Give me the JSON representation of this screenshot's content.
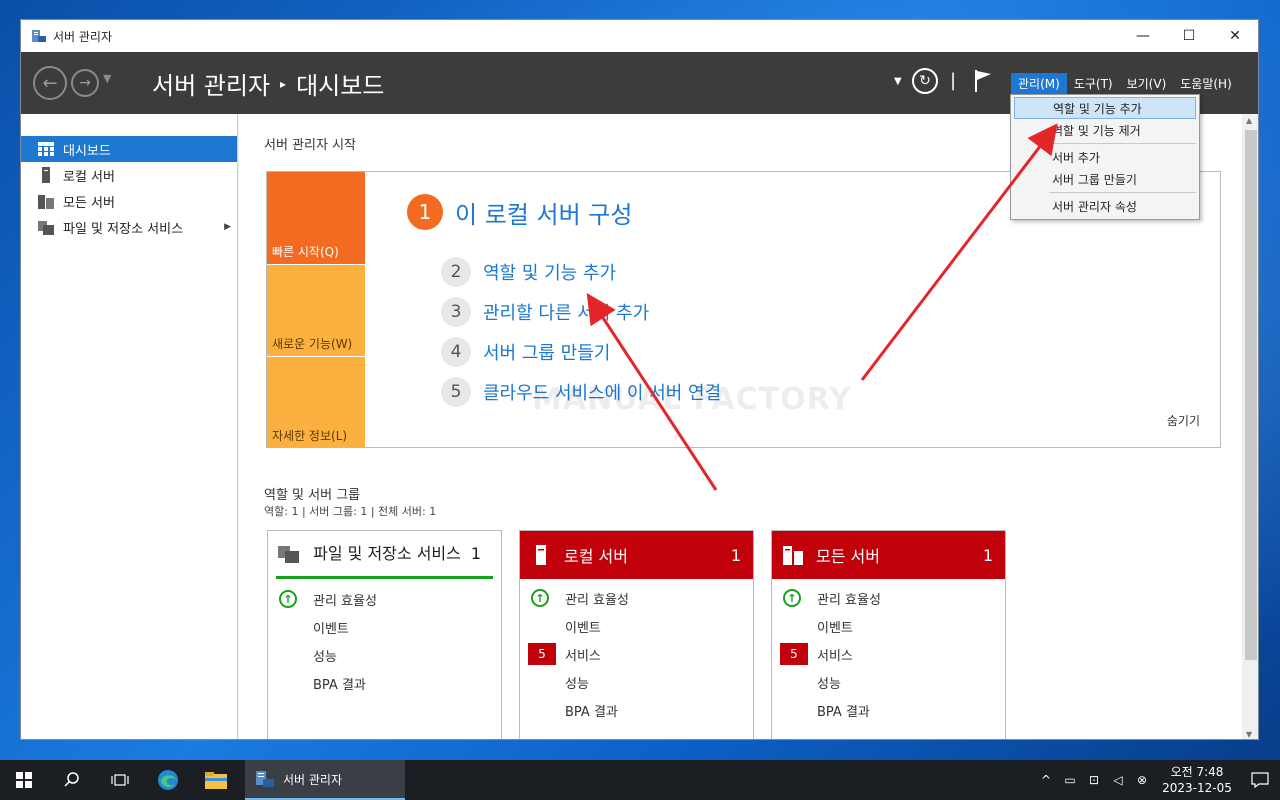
{
  "window": {
    "title": "서버 관리자",
    "minimize": "—",
    "maximize": "☐",
    "close": "✕"
  },
  "header": {
    "title": "서버 관리자",
    "separator": "▸",
    "page": "대시보드"
  },
  "menubar": {
    "items": [
      "관리(M)",
      "도구(T)",
      "보기(V)",
      "도움말(H)"
    ],
    "active_index": 0
  },
  "dropdown": {
    "items": [
      "역할 및 기능 추가",
      "역할 및 기능 제거",
      "서버 추가",
      "서버 그룹 만들기",
      "서버 관리자 속성"
    ]
  },
  "sidebar": {
    "items": [
      {
        "label": "대시보드",
        "icon": "dashboard-icon",
        "selected": true
      },
      {
        "label": "로컬 서버",
        "icon": "server-icon"
      },
      {
        "label": "모든 서버",
        "icon": "servers-icon"
      },
      {
        "label": "파일 및 저장소 서비스",
        "icon": "storage-icon",
        "has_children": true
      }
    ]
  },
  "quickstart": {
    "section_title": "서버 관리자 시작",
    "tabs": [
      "빠른 시작(Q)",
      "새로운 기능(W)",
      "자세한 정보(L)"
    ],
    "main_step": {
      "num": "1",
      "label": "이 로컬 서버 구성"
    },
    "steps": [
      {
        "num": "2",
        "label": "역할 및 기능 추가"
      },
      {
        "num": "3",
        "label": "관리할 다른 서버 추가"
      },
      {
        "num": "4",
        "label": "서버 그룹 만들기"
      },
      {
        "num": "5",
        "label": "클라우드 서비스에 이 서버 연결"
      }
    ],
    "hide": "숨기기",
    "watermark": "MANUAL FACTORY"
  },
  "roles": {
    "title": "역할 및 서버 그룹",
    "summary": "역할: 1   |   서버 그룹: 1   |   전체 서버: 1",
    "tiles": [
      {
        "name": "파일 및 저장소 서비스",
        "count": "1",
        "style": "green",
        "rows": [
          {
            "label": "관리 효율성",
            "badge": "ok"
          },
          {
            "label": "이벤트"
          },
          {
            "label": "성능"
          },
          {
            "label": "BPA 결과"
          }
        ]
      },
      {
        "name": "로컬 서버",
        "count": "1",
        "style": "red",
        "rows": [
          {
            "label": "관리 효율성",
            "badge": "ok"
          },
          {
            "label": "이벤트"
          },
          {
            "label": "서비스",
            "badge": "5"
          },
          {
            "label": "성능"
          },
          {
            "label": "BPA 결과"
          }
        ]
      },
      {
        "name": "모든 서버",
        "count": "1",
        "style": "red",
        "rows": [
          {
            "label": "관리 효율성",
            "badge": "ok"
          },
          {
            "label": "이벤트"
          },
          {
            "label": "서비스",
            "badge": "5"
          },
          {
            "label": "성능"
          },
          {
            "label": "BPA 결과"
          }
        ]
      }
    ]
  },
  "taskbar": {
    "app_label": "서버 관리자",
    "time": "오전 7:48",
    "date": "2023-12-05"
  },
  "colors": {
    "accent": "#1e78d2",
    "orange": "#f26b21",
    "amber": "#fbb040",
    "red": "#c0000b",
    "green": "#16a11a"
  }
}
